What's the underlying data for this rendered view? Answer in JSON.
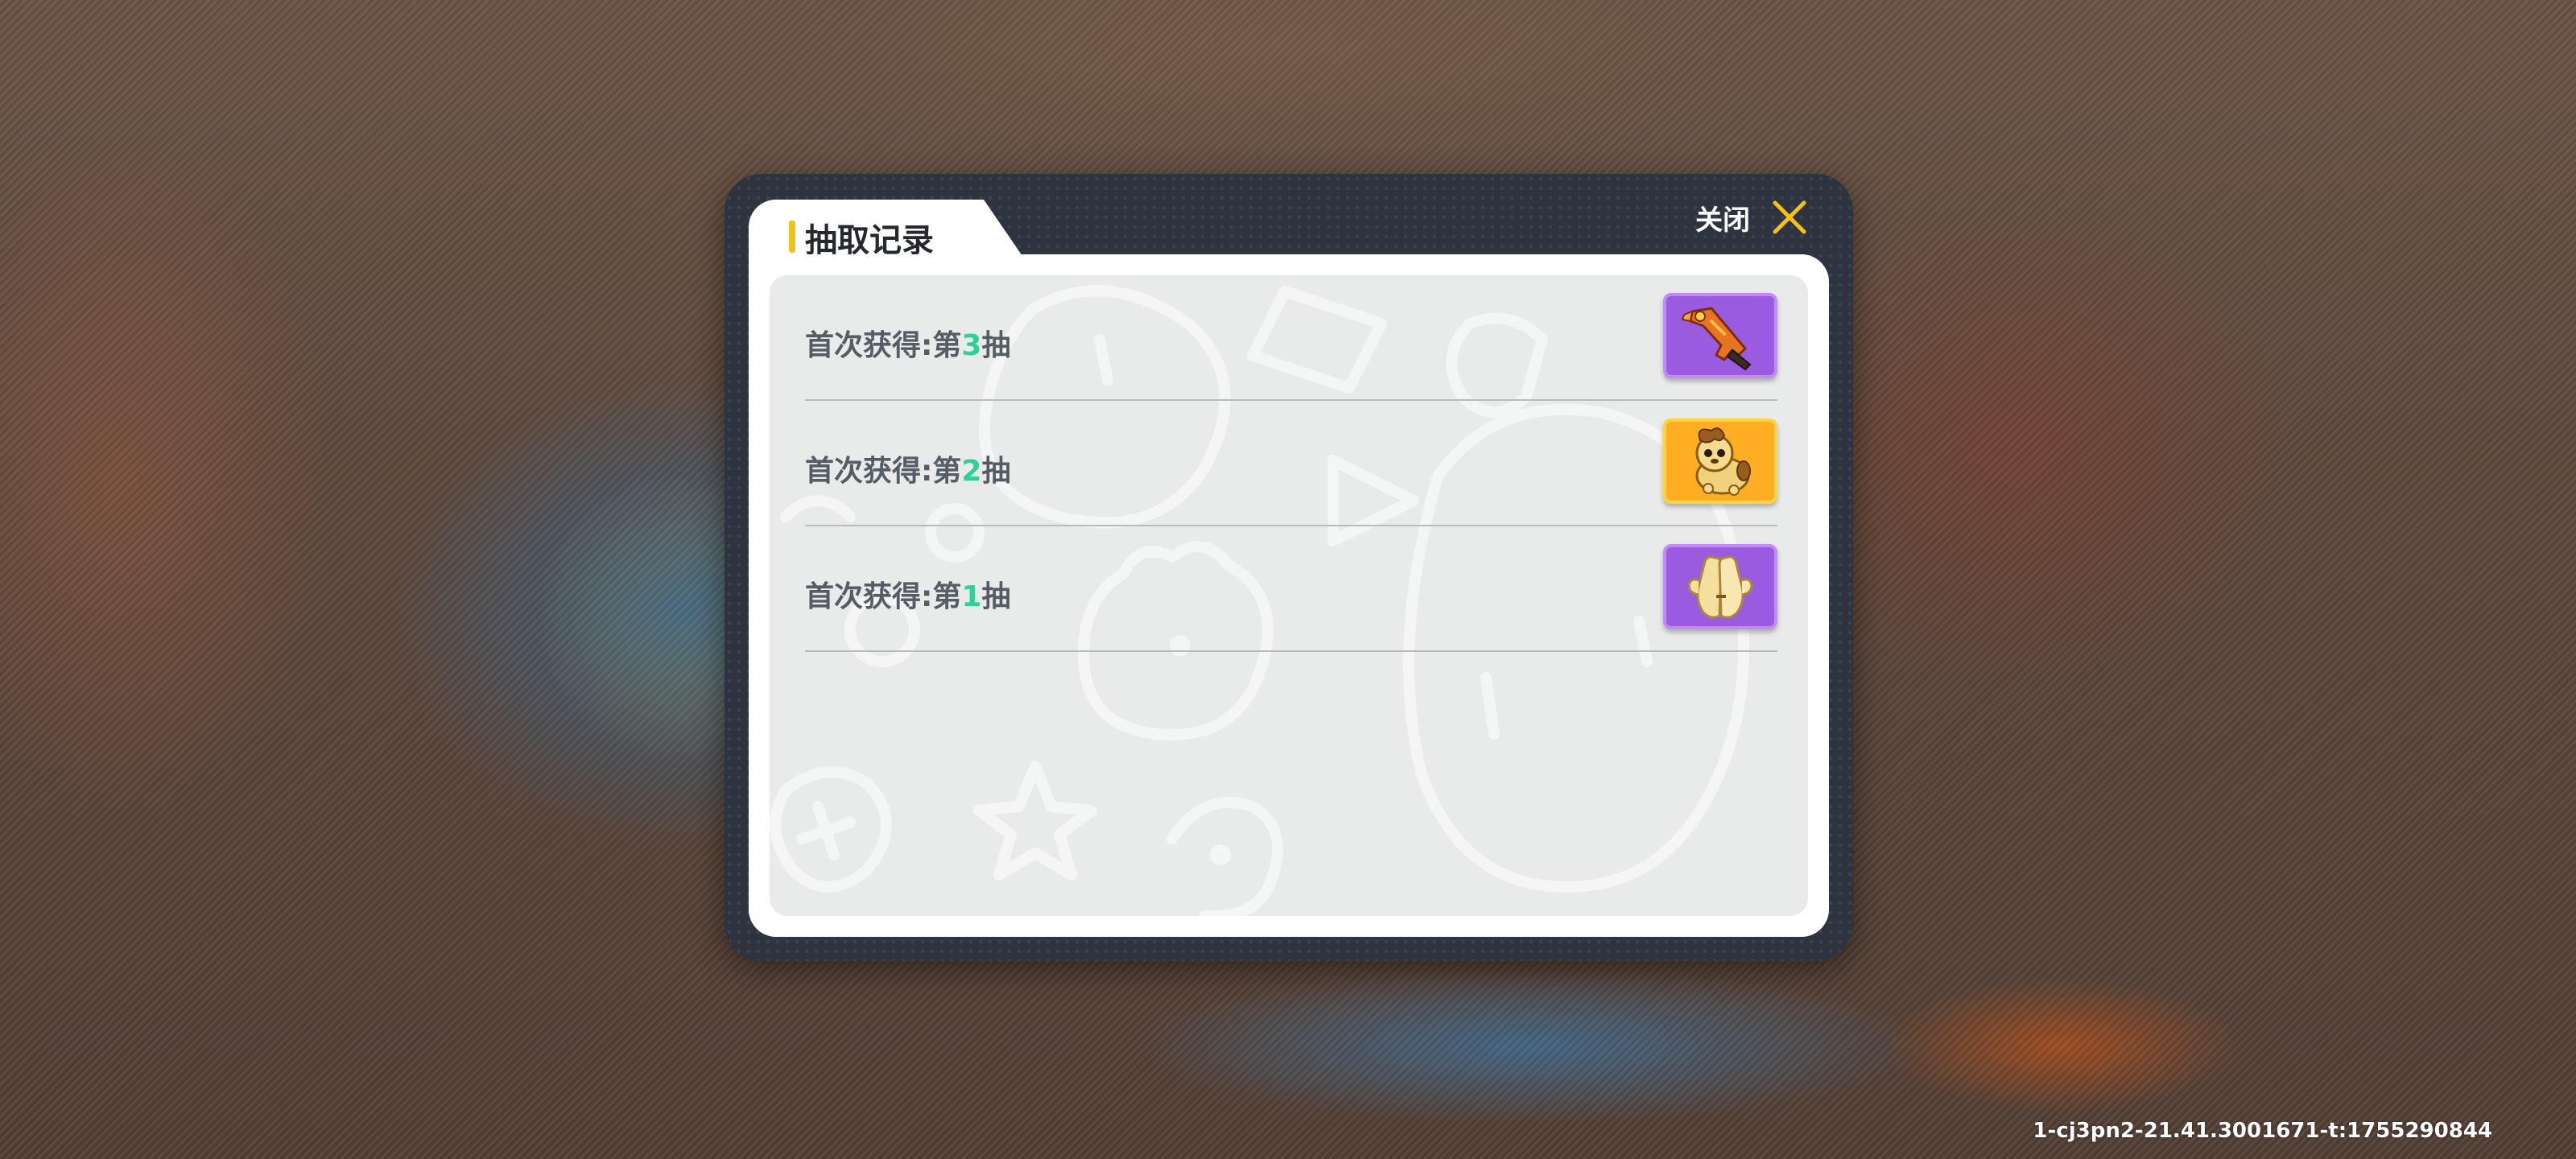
{
  "dialog": {
    "title": "抽取记录",
    "close_label": "关闭",
    "accent_color": "#f2c21b"
  },
  "records": [
    {
      "prefix": "首次获得:第",
      "number": "3",
      "suffix": "抽",
      "item_icon": "toy-gun-icon",
      "rarity_color": "#9b5be0"
    },
    {
      "prefix": "首次获得:第",
      "number": "2",
      "suffix": "抽",
      "item_icon": "puppy-icon",
      "rarity_color": "#ffae23"
    },
    {
      "prefix": "首次获得:第",
      "number": "1",
      "suffix": "抽",
      "item_icon": "gloves-icon",
      "rarity_color": "#9b5be0"
    }
  ],
  "watermark": "1-cj3pn2-21.41.3001671-t:1755290844"
}
